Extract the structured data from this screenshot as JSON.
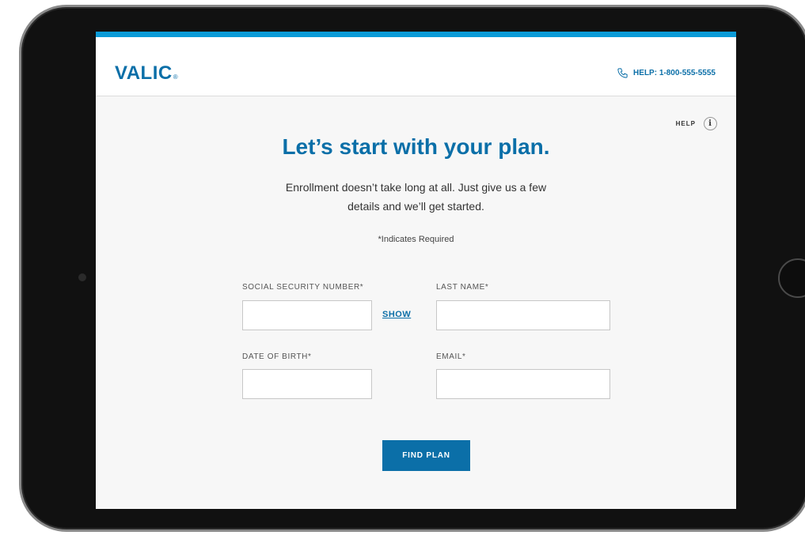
{
  "brand": {
    "logo_text": "VALIC",
    "logo_mark": "®",
    "accent_color": "#0b6fa8",
    "strip_color": "#0b9ad7"
  },
  "header": {
    "help_phone": "HELP: 1-800-555-5555",
    "phone_icon": "phone-icon"
  },
  "help": {
    "label": "HELP",
    "icon": "info-icon",
    "icon_glyph": "i"
  },
  "intro": {
    "title": "Let’s start with your plan.",
    "subtitle": "Enrollment doesn’t take long at all. Just give us a few details and we’ll get started.",
    "required_note": "*Indicates Required"
  },
  "form": {
    "ssn_label": "SOCIAL SECURITY NUMBER*",
    "ssn_value": "",
    "show_label": "SHOW",
    "last_name_label": "LAST NAME*",
    "last_name_value": "",
    "dob_label": "DATE OF BIRTH*",
    "dob_value": "",
    "email_label": "EMAIL*",
    "email_value": "",
    "submit_label": "FIND PLAN"
  }
}
